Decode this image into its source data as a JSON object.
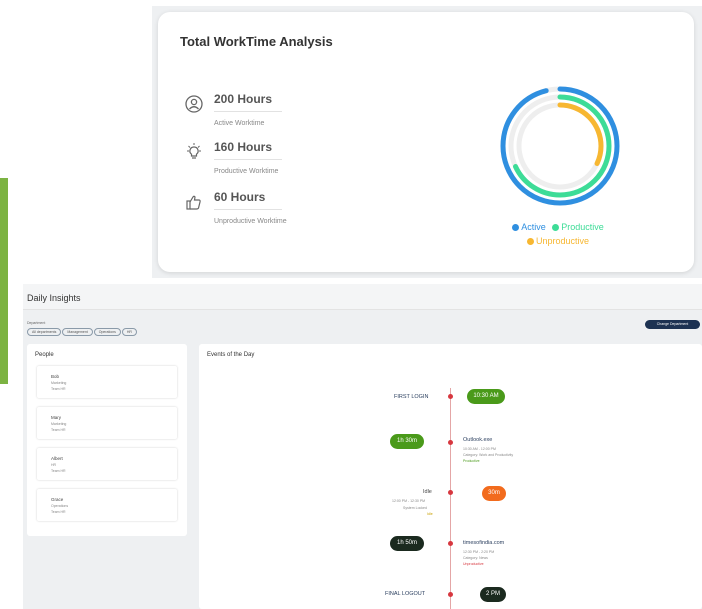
{
  "worktime": {
    "title": "Total WorkTime Analysis",
    "metrics": [
      {
        "value": "200 Hours",
        "label": "Active Worktime",
        "icon": "user-circle-icon"
      },
      {
        "value": "160 Hours",
        "label": "Productive Worktime",
        "icon": "lightbulb-icon"
      },
      {
        "value": "60 Hours",
        "label": "Unproductive Worktime",
        "icon": "hand-down-icon"
      }
    ],
    "chart": {
      "rings": [
        {
          "name": "Active",
          "color": "#2f8fe0",
          "fraction": 0.96
        },
        {
          "name": "Productive",
          "color": "#3ddc97",
          "fraction": 0.68
        },
        {
          "name": "Unproductive",
          "color": "#f7b731",
          "fraction": 0.32
        }
      ],
      "track_color": "#eeeeee"
    },
    "legend": [
      {
        "label": "Active",
        "color": "#2f8fe0"
      },
      {
        "label": "Productive",
        "color": "#3ddc97"
      },
      {
        "label": "Unproductive",
        "color": "#f7b731"
      }
    ]
  },
  "daily": {
    "title": "Daily Insights",
    "department_label": "Department",
    "chips": [
      "All departments",
      "Management",
      "Operations",
      "HR"
    ],
    "change_button": "Change Department",
    "people_title": "People",
    "people": [
      {
        "name": "Bob",
        "role": "Marketing",
        "status": "Team HR"
      },
      {
        "name": "Mary",
        "role": "Marketing",
        "status": "Team HR"
      },
      {
        "name": "Albert",
        "role": "HR",
        "status": "Team HR"
      },
      {
        "name": "Grace",
        "role": "Operations",
        "status": "Team HR"
      }
    ],
    "events_title": "Events of the Day",
    "events": {
      "first_login": {
        "label": "FIRST LOGIN",
        "time": "10:30 AM"
      },
      "outlook": {
        "duration": "1h 30m",
        "app": "Outlook.exe",
        "time_range": "10:30 AM - 12:00 PM",
        "category": "Category: Work and Productivity",
        "tag": "Productive"
      },
      "idle": {
        "label": "Idle",
        "time_range": "12:00 PM - 12:30 PM",
        "note": "System Locked",
        "tag": "Idle",
        "duration": "30m"
      },
      "timesofindia": {
        "duration": "1h 50m",
        "site": "timesofindia.com",
        "time_range": "12:30 PM - 2:20 PM",
        "category": "Category: News",
        "tag": "Unproductive"
      },
      "final_logout": {
        "label": "FINAL LOGOUT",
        "time": "2 PM"
      }
    }
  }
}
